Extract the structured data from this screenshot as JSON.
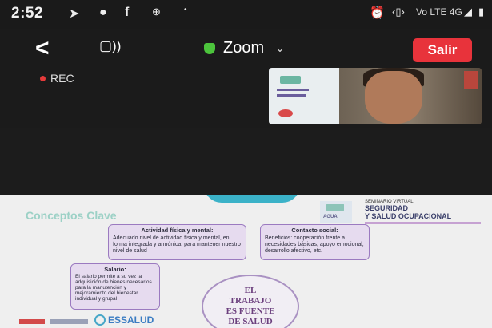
{
  "status_bar": {
    "time": "2:52",
    "network": "Vo LTE 4G",
    "icons": [
      "send-icon",
      "chat-icon",
      "facebook-icon",
      "dots-icon",
      "alarm-icon",
      "vibrate-icon",
      "signal-icon",
      "battery-icon"
    ]
  },
  "toolbar": {
    "back_label": "<",
    "speaker_label": "▢))",
    "title": "Zoom",
    "exit_label": "Salir",
    "rec_label": "REC"
  },
  "slide": {
    "title": "Conceptos Clave",
    "brand_name": "AGUA",
    "event_small": "SEMINARIO VIRTUAL",
    "event_title_1": "SEGURIDAD",
    "event_title_2": "Y SALUD OCUPACIONAL",
    "box_activity_title": "Actividad física y mental:",
    "box_activity_text": "Adecuado nivel de actividad física y mental, en forma integrada y armónica, para mantener nuestro nivel de salud",
    "box_contact_title": "Contacto social:",
    "box_contact_text": "Beneficios: cooperación frente a necesidades básicas, apoyo emocional, desarrollo afectivo, etc.",
    "box_salary_title": "Salario:",
    "box_salary_text": "El salario permite a su vez la adquisición de bienes necesarios para la manutención y mejoramiento del bienestar individual y grupal",
    "center_line_1": "EL",
    "center_line_2": "TRABAJO",
    "center_line_3": "ES FUENTE",
    "center_line_4": "DE SALUD",
    "footer_logo": "ESSALUD"
  },
  "colors": {
    "exit_button": "#e8333b",
    "rec_dot": "#e53a3a",
    "zoom_shield": "#4cc43c",
    "accent_purple": "#9b7ac0",
    "title_teal": "#9cd1c6"
  }
}
